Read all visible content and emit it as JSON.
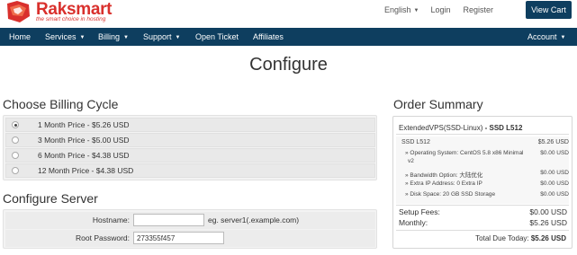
{
  "brand": {
    "name": "Raksmart",
    "tagline": "the smart choice in hosting",
    "color": "#d9302c"
  },
  "top_links": {
    "language": "English",
    "login": "Login",
    "register": "Register",
    "view_cart": "View Cart"
  },
  "nav": {
    "color": "#0e3e5f",
    "items": [
      {
        "label": "Home",
        "dropdown": false
      },
      {
        "label": "Services",
        "dropdown": true
      },
      {
        "label": "Billing",
        "dropdown": true
      },
      {
        "label": "Support",
        "dropdown": true
      },
      {
        "label": "Open Ticket",
        "dropdown": false
      },
      {
        "label": "Affiliates",
        "dropdown": false
      }
    ],
    "account": "Account"
  },
  "page_title": "Configure",
  "billing": {
    "heading": "Choose Billing Cycle",
    "options": [
      {
        "label": "1 Month Price - $5.26 USD",
        "checked": true
      },
      {
        "label": "3 Month Price - $5.00 USD",
        "checked": false
      },
      {
        "label": "6 Month Price - $4.38 USD",
        "checked": false
      },
      {
        "label": "12 Month Price - $4.38 USD",
        "checked": false
      }
    ]
  },
  "server": {
    "heading": "Configure Server",
    "hostname_label": "Hostname:",
    "hostname_value": "",
    "hostname_hint": "eg. server1(.example.com)",
    "password_label": "Root Password:",
    "password_value": "273355f457"
  },
  "order": {
    "heading": "Order Summary",
    "product_group": "ExtendedVPS(SSD-Linux)",
    "product_sep": " - ",
    "product_name": "SSD L512",
    "lines": [
      {
        "label": "SSD L512",
        "value": "$5.26 USD"
      },
      {
        "label": "» Operating System: CentOS 5.8 x86 Minimal",
        "label2": "v2",
        "value": "$0.00 USD"
      },
      {
        "label": "» Bandwidth Option: 大陆优化",
        "value": "$0.00 USD"
      },
      {
        "label": "» Extra IP Address: 0 Extra IP",
        "value": "$0.00 USD"
      },
      {
        "label": "» Disk Space: 20 GB SSD Storage",
        "value": "$0.00 USD"
      }
    ],
    "setup_label": "Setup Fees:",
    "setup_value": "$0.00 USD",
    "monthly_label": "Monthly:",
    "monthly_value": "$5.26 USD",
    "due_label": "Total Due Today:",
    "due_value": "$5.26 USD"
  }
}
